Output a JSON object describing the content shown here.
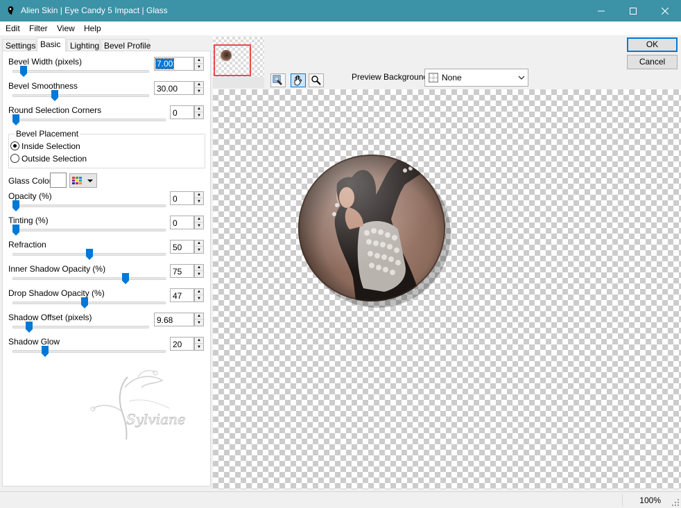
{
  "window": {
    "title": "Alien Skin | Eye Candy 5 Impact | Glass",
    "title_bar_color": "#3c92a6"
  },
  "menu": [
    "Edit",
    "Filter",
    "View",
    "Help"
  ],
  "tabs": [
    "Settings",
    "Basic",
    "Lighting",
    "Bevel Profile"
  ],
  "active_tab": "Basic",
  "params": {
    "bevel_width": {
      "label": "Bevel Width (pixels)",
      "value": "7.00",
      "slider_fraction": 0.06
    },
    "bevel_smoothness": {
      "label": "Bevel Smoothness",
      "value": "30.00",
      "slider_fraction": 0.3
    },
    "round_corners": {
      "label": "Round Selection Corners",
      "value": "0",
      "slider_fraction": 0.0
    },
    "opacity": {
      "label": "Opacity (%)",
      "value": "0",
      "slider_fraction": 0.0
    },
    "tinting": {
      "label": "Tinting (%)",
      "value": "0",
      "slider_fraction": 0.0
    },
    "refraction": {
      "label": "Refraction",
      "value": "50",
      "slider_fraction": 0.5
    },
    "inner_shadow": {
      "label": "Inner Shadow Opacity (%)",
      "value": "75",
      "slider_fraction": 0.75
    },
    "drop_shadow": {
      "label": "Drop Shadow Opacity (%)",
      "value": "47",
      "slider_fraction": 0.47
    },
    "shadow_offset": {
      "label": "Shadow Offset (pixels)",
      "value": "9.68",
      "slider_fraction": 0.1
    },
    "shadow_glow": {
      "label": "Shadow Glow",
      "value": "20",
      "slider_fraction": 0.2
    }
  },
  "bevel_placement": {
    "legend": "Bevel Placement",
    "options": [
      "Inside Selection",
      "Outside Selection"
    ],
    "selected": "Inside Selection"
  },
  "glass_color": {
    "label": "Glass Color",
    "value": "#ffffff"
  },
  "preview_background": {
    "label": "Preview Background:",
    "value": "None"
  },
  "buttons": {
    "ok": "OK",
    "cancel": "Cancel"
  },
  "watermark": "Sylviane",
  "status": {
    "zoom": "100%"
  },
  "icons": [
    "app-icon",
    "minimize-icon",
    "maximize-icon",
    "close-icon",
    "navigate-icon",
    "hand-icon",
    "zoom-icon",
    "chevron-down-icon",
    "size-grip-icon"
  ]
}
